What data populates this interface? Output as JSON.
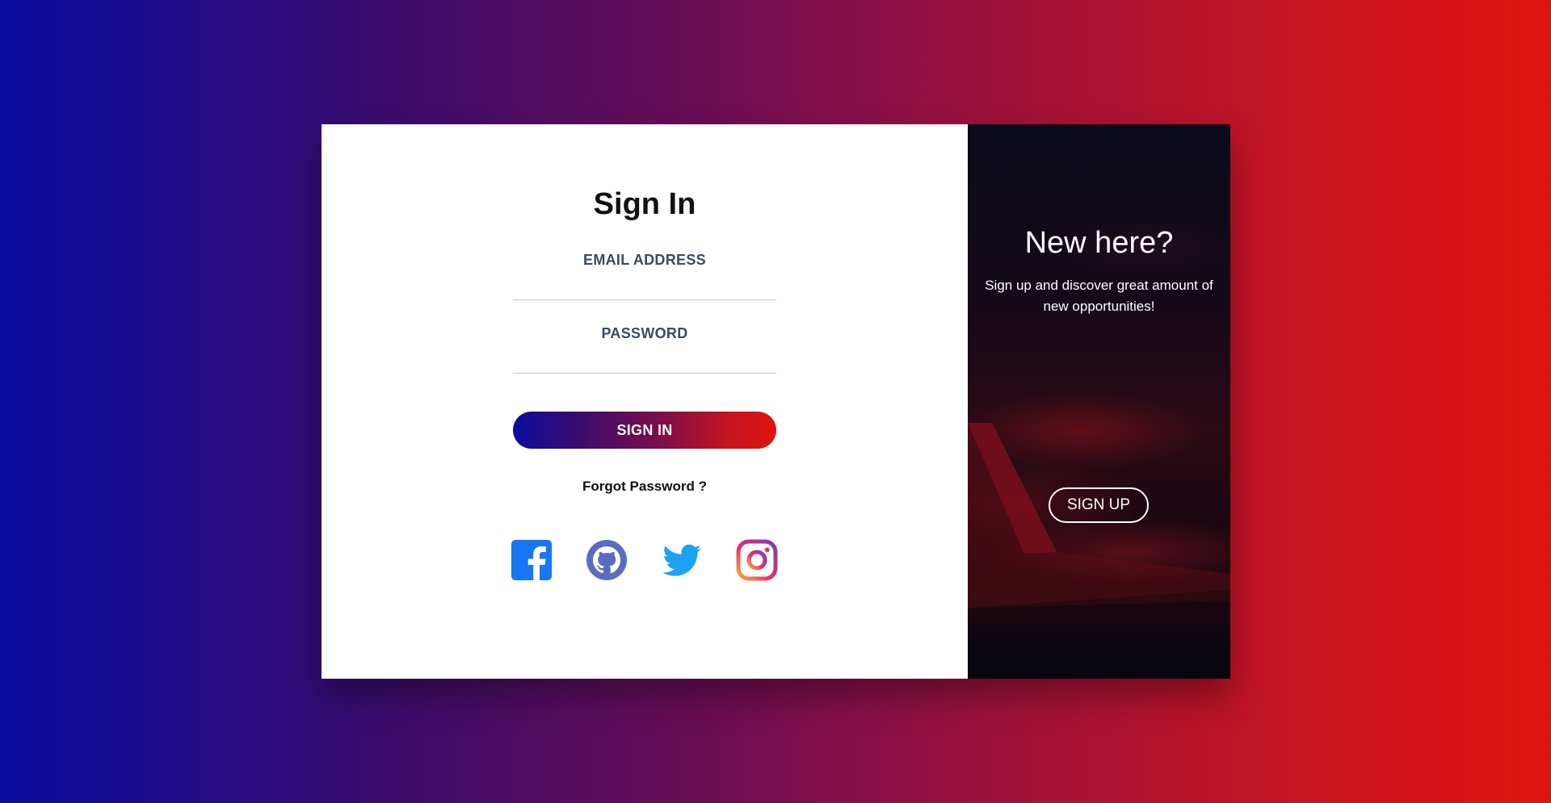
{
  "signin": {
    "title": "Sign In",
    "email_label": "EMAIL ADDRESS",
    "email_value": "",
    "password_label": "PASSWORD",
    "password_value": "",
    "submit_label": "SIGN IN",
    "forgot_label": "Forgot Password ?",
    "social": [
      {
        "icon": "facebook-icon",
        "color": "#1877f2"
      },
      {
        "icon": "github-icon",
        "color": "#5c6bc0"
      },
      {
        "icon": "twitter-icon",
        "color": "#1da1f2"
      },
      {
        "icon": "instagram-icon",
        "color": "#c13584"
      }
    ]
  },
  "signup": {
    "title": "New here?",
    "text": "Sign up and discover great amount of new opportunities!",
    "button_label": "SIGN UP"
  },
  "colors": {
    "gradient_start": "#0a0c9f",
    "gradient_end": "#e0140f",
    "card_background": "#ffffff",
    "label_color": "#3b4b5f"
  }
}
